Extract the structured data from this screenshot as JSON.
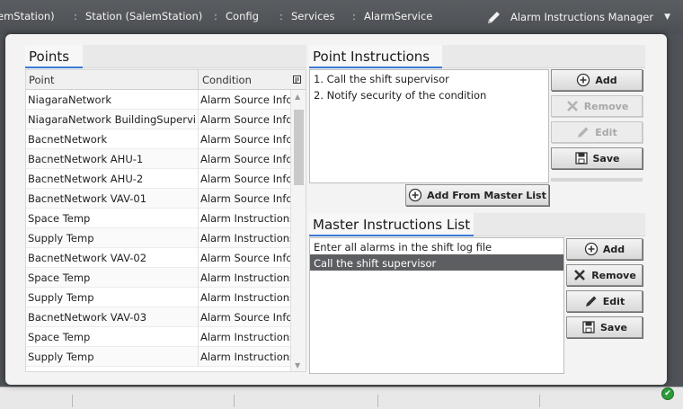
{
  "nav": {
    "crumbs": [
      "emStation)",
      "Station (SalemStation)",
      "Config",
      "Services",
      "AlarmService"
    ],
    "view_title": "Alarm Instructions Manager"
  },
  "points": {
    "title": "Points",
    "columns": [
      "Point",
      "Condition"
    ],
    "rows": [
      {
        "point": "NiagaraNetwork",
        "condition": "Alarm Source Info"
      },
      {
        "point": "NiagaraNetwork BuildingSupervisor",
        "condition": "Alarm Source Info"
      },
      {
        "point": "BacnetNetwork",
        "condition": "Alarm Source Info"
      },
      {
        "point": "BacnetNetwork AHU-1",
        "condition": "Alarm Source Info"
      },
      {
        "point": "BacnetNetwork AHU-2",
        "condition": "Alarm Source Info"
      },
      {
        "point": "BacnetNetwork VAV-01",
        "condition": "Alarm Source Info"
      },
      {
        "point": "Space Temp",
        "condition": "Alarm Instructions"
      },
      {
        "point": "Supply Temp",
        "condition": "Alarm Instructions"
      },
      {
        "point": "BacnetNetwork VAV-02",
        "condition": "Alarm Source Info"
      },
      {
        "point": "Space Temp",
        "condition": "Alarm Instructions"
      },
      {
        "point": "Supply Temp",
        "condition": "Alarm Instructions"
      },
      {
        "point": "BacnetNetwork VAV-03",
        "condition": "Alarm Source Info"
      },
      {
        "point": "Space Temp",
        "condition": "Alarm Instructions"
      },
      {
        "point": "Supply Temp",
        "condition": "Alarm Instructions"
      }
    ]
  },
  "point_instructions": {
    "title": "Point Instructions",
    "items": [
      "1. Call the shift supervisor",
      "2. Notify security of the condition"
    ],
    "buttons": {
      "add": "Add",
      "remove": "Remove",
      "edit": "Edit",
      "save": "Save"
    },
    "add_from_master": "Add From Master List"
  },
  "master_list": {
    "title": "Master Instructions List",
    "items": [
      "Enter all alarms in the shift log file",
      "Call the shift supervisor"
    ],
    "selected_index": 1,
    "buttons": {
      "add": "Add",
      "remove": "Remove",
      "edit": "Edit",
      "save": "Save"
    }
  },
  "colors": {
    "selection": "#5c5e61",
    "tab_underline": "#3b7ad4",
    "status_ok": "#2d9b3a"
  }
}
